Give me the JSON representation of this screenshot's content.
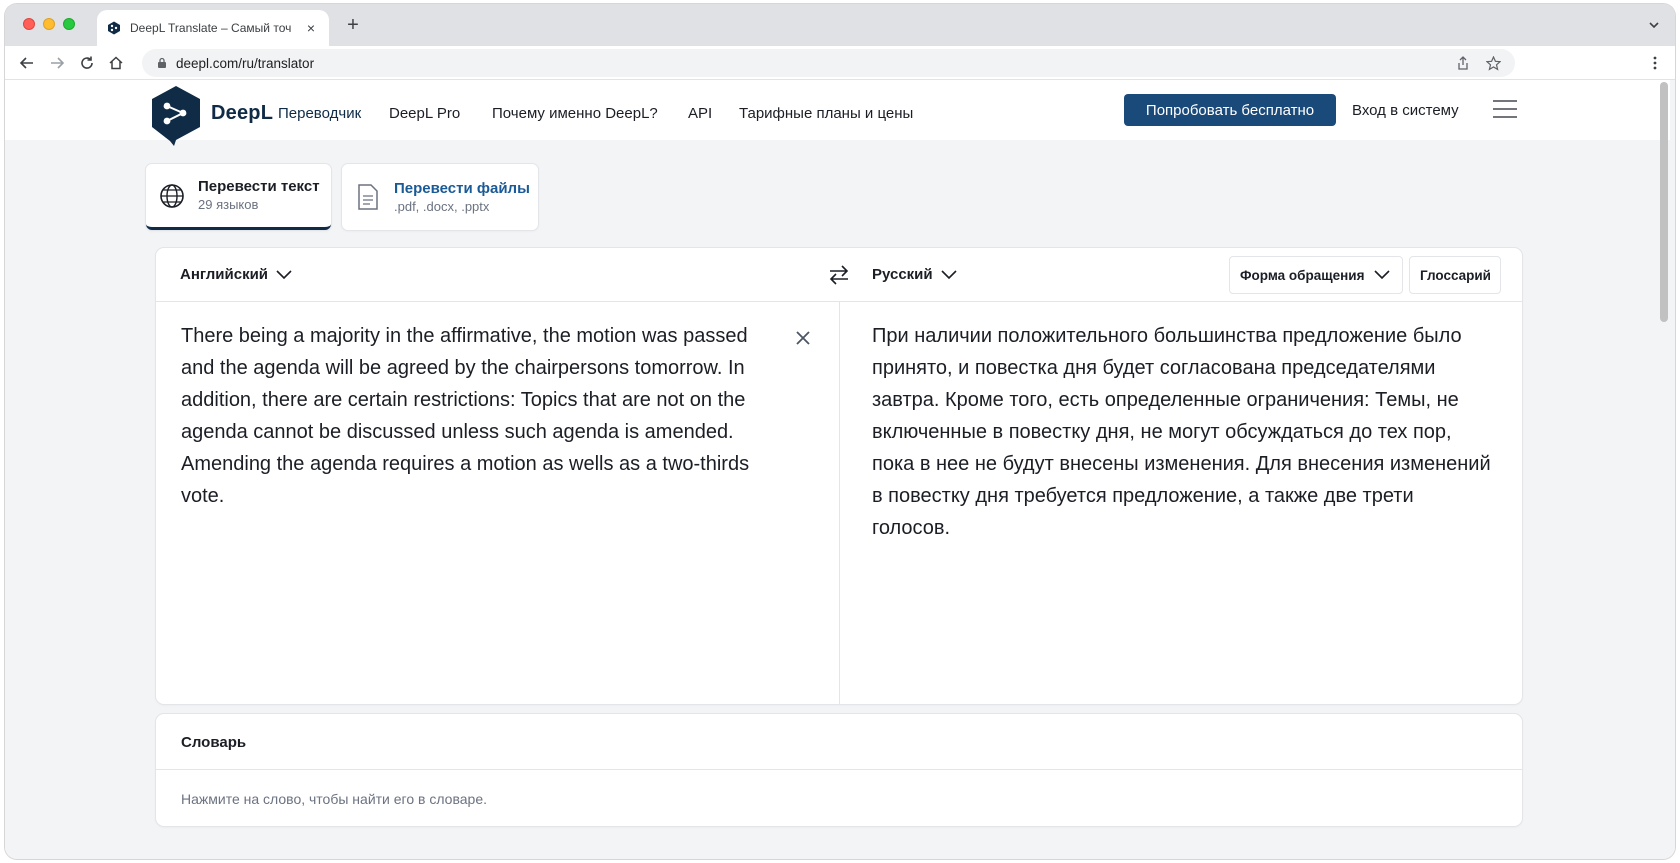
{
  "browser": {
    "tab_title": "DeepL Translate – Самый точ",
    "tab_close": "×",
    "new_tab": "+",
    "url": "deepl.com/ru/translator"
  },
  "header": {
    "logo_text": "DeepL",
    "logo_sub": "Переводчик",
    "nav": [
      "DeepL Pro",
      "Почему именно DeepL?",
      "API",
      "Тарифные планы и цены"
    ],
    "cta": "Попробовать бесплатно",
    "login": "Вход в систему"
  },
  "mode_tabs": [
    {
      "title": "Перевести текст",
      "sub": "29 языков",
      "icon": "globe-icon"
    },
    {
      "title": "Перевести файлы",
      "sub": ".pdf, .docx, .pptx",
      "icon": "document-icon"
    }
  ],
  "translator": {
    "source_lang": "Английский",
    "target_lang": "Русский",
    "formality": "Форма обращения",
    "glossary": "Глоссарий",
    "source_text": "There being a majority in the affirmative, the motion was passed and the agenda will be agreed by the chairpersons tomorrow. In addition, there are certain restrictions: Topics that are not on the agenda cannot be discussed unless such agenda is amended. Amending the agenda requires a motion as wells as a two-thirds vote.",
    "target_text": "При наличии положительного большинства предложение было принято, и повестка дня будет согласована председателями завтра. Кроме того, есть определенные ограничения: Темы, не включенные в повестку дня, не могут обсуждаться до тех пор, пока в нее не будут внесены изменения. Для внесения изменений в повестку дня требуется предложение, а также две трети голосов."
  },
  "dictionary": {
    "title": "Словарь",
    "hint": "Нажмите на слово, чтобы найти его в словаре."
  },
  "colors": {
    "brand_navy": "#0f2b46",
    "cta_blue": "#1a4a7a",
    "page_bg": "#f3f4f6"
  }
}
